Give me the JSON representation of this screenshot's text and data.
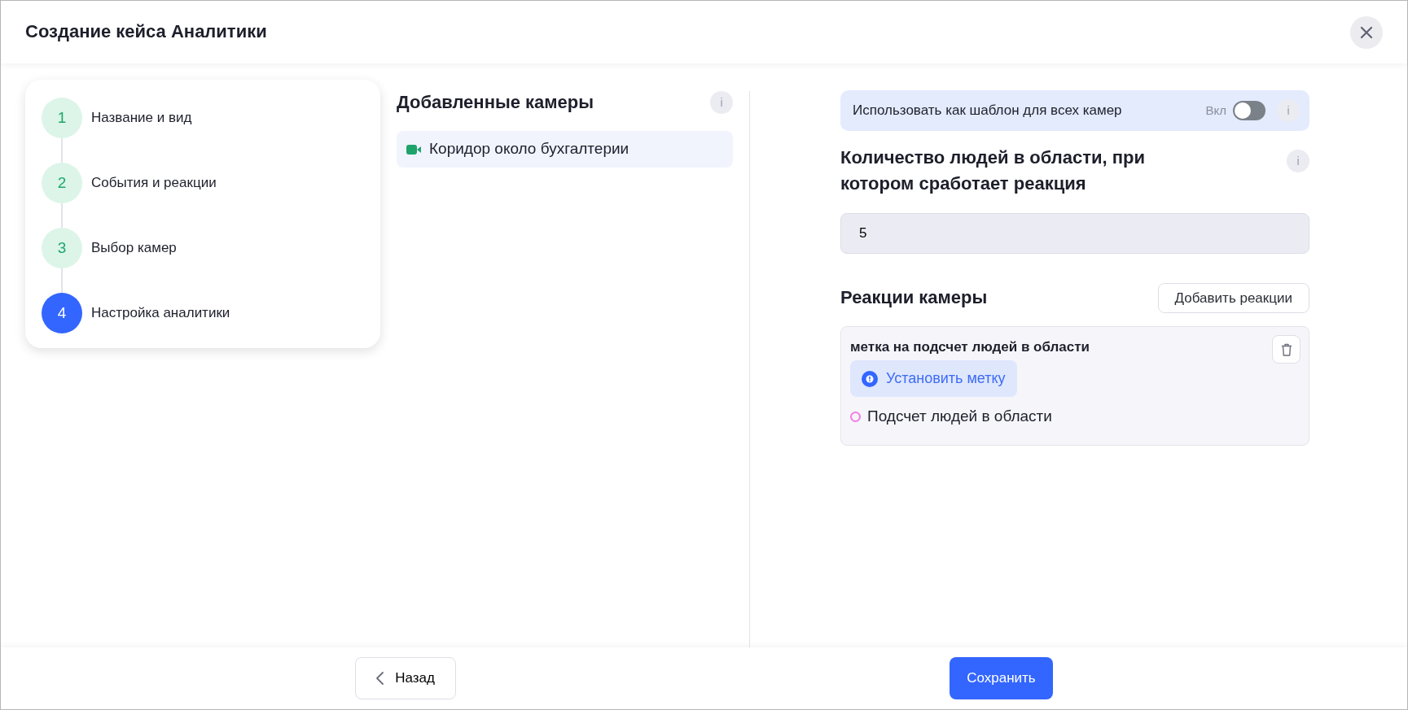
{
  "window": {
    "title": "Создание кейса Аналитики"
  },
  "steps": [
    {
      "number": "1",
      "label": "Название и вид",
      "selected": false
    },
    {
      "number": "2",
      "label": "События и реакции",
      "selected": false
    },
    {
      "number": "3",
      "label": "Выбор камер",
      "selected": false
    },
    {
      "number": "4",
      "label": "Настройка аналитики",
      "selected": true
    }
  ],
  "cameras": {
    "title": "Добавленные камеры",
    "info": "i",
    "items": [
      {
        "label": "Коридор около бухгалтерии"
      }
    ]
  },
  "template": {
    "label": "Использовать как шаблон для всех камер",
    "state_label": "Вкл",
    "on": false,
    "info": "i"
  },
  "threshold": {
    "label": "Количество людей в области, при котором сработает реакция",
    "info": "i",
    "value": "5"
  },
  "reactions": {
    "title": "Реакции камеры",
    "add_button": "Добавить реакции",
    "items": [
      {
        "title": "метка на подсчет людей в области",
        "action": "Установить метку",
        "tag": {
          "label": "Подсчет людей в области",
          "color": "#f47ce6"
        }
      }
    ]
  },
  "footer": {
    "back": "Назад",
    "save": "Сохранить"
  }
}
